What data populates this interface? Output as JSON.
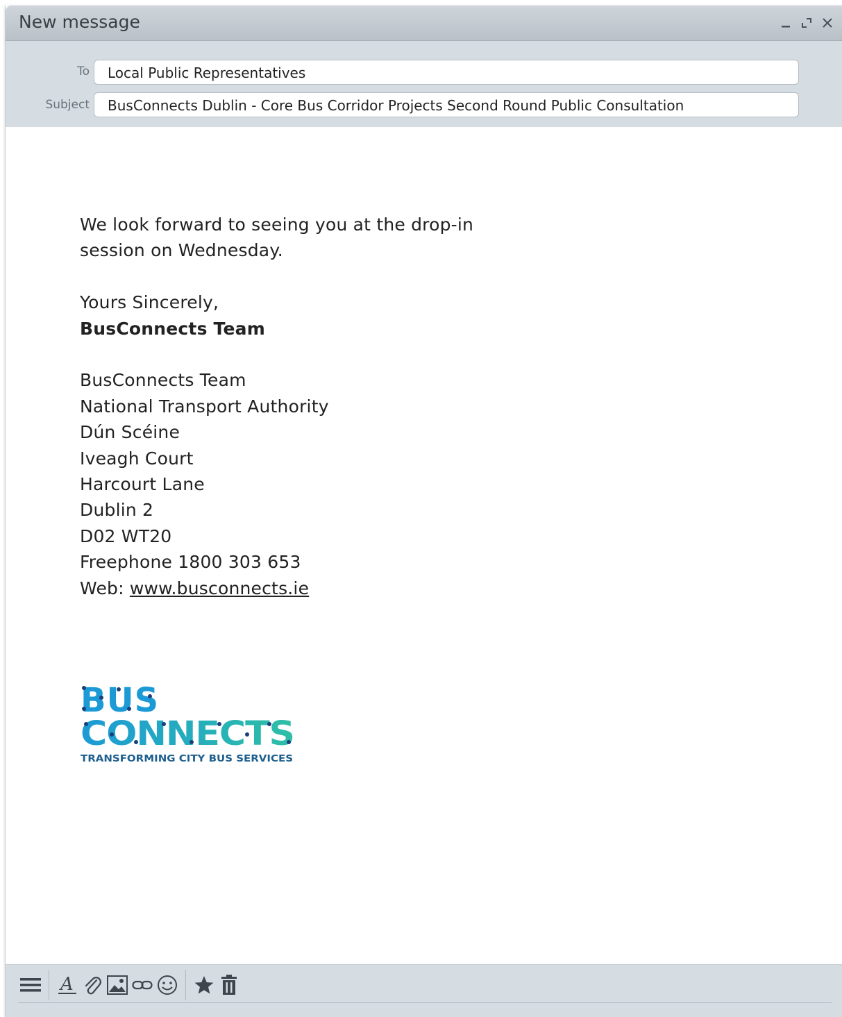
{
  "window": {
    "title": "New message",
    "controls": [
      "minimize-icon",
      "expand-icon",
      "close-icon"
    ]
  },
  "header": {
    "to_label": "To",
    "to_value": "Local Public Representatives",
    "subject_label": "Subject",
    "subject_value": "BusConnects Dublin - Core Bus Corridor Projects Second Round Public Consultation"
  },
  "body": {
    "line1": "We look forward to seeing you at the drop-in",
    "line2": "session on Wednesday.",
    "closing": "Yours Sincerely,",
    "sender_bold": "BusConnects Team",
    "address": [
      "BusConnects Team",
      "National Transport Authority",
      "Dún Scéine",
      "Iveagh Court",
      "Harcourt Lane",
      "Dublin 2",
      "D02 WT20",
      "Freephone 1800 303 653"
    ],
    "web_label": "Web: ",
    "web_link": "www.busconnects.ie"
  },
  "logo": {
    "line1": "BUS",
    "line2": "CONNECTS",
    "tagline": "TRANSFORMING CITY BUS SERVICES",
    "colors": {
      "blue": "#1c9ad6",
      "teal": "#2ebfa5",
      "navy": "#1b3f7a",
      "tagline": "#1d5f8e"
    }
  },
  "toolbar": {
    "icons": [
      "menu-icon",
      "text-format-icon",
      "attachment-icon",
      "image-icon",
      "link-icon",
      "emoji-icon",
      "star-icon",
      "trash-icon"
    ]
  },
  "colors": {
    "titlebar": "#c3cad0",
    "header_bg": "#d6dde2",
    "text": "#222222"
  }
}
